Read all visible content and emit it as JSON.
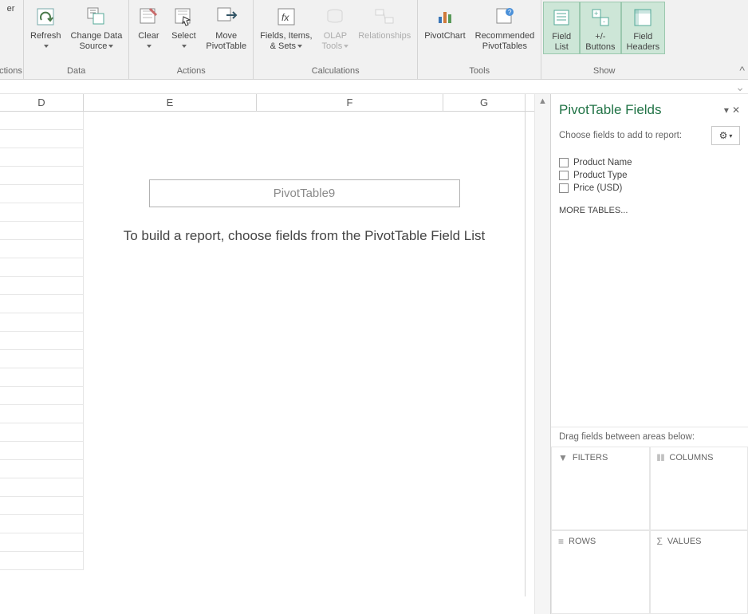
{
  "ribbon": {
    "partial_label": "ctions",
    "partial_hint": "er",
    "data": {
      "label": "Data",
      "refresh": "Refresh",
      "change_data_source": "Change Data\nSource"
    },
    "actions": {
      "label": "Actions",
      "clear": "Clear",
      "select": "Select",
      "move": "Move\nPivotTable"
    },
    "calculations": {
      "label": "Calculations",
      "fields_items_sets": "Fields, Items,\n& Sets",
      "olap_tools": "OLAP\nTools",
      "relationships": "Relationships"
    },
    "tools": {
      "label": "Tools",
      "pivotchart": "PivotChart",
      "recommended": "Recommended\nPivotTables"
    },
    "show": {
      "label": "Show",
      "field_list": "Field\nList",
      "plusminus": "+/-\nButtons",
      "field_headers": "Field\nHeaders"
    }
  },
  "columns": {
    "d": "D",
    "e": "E",
    "f": "F",
    "g": "G"
  },
  "pivot": {
    "name": "PivotTable9",
    "instructions": "To build a report, choose fields from the PivotTable Field List"
  },
  "task_pane": {
    "title": "PivotTable Fields",
    "choose_text": "Choose fields to add to report:",
    "fields": {
      "f1": "Product Name",
      "f2": "Product Type",
      "f3": "Price (USD)"
    },
    "more_tables": "MORE TABLES...",
    "drag_text": "Drag fields between areas below:",
    "areas": {
      "filters": "FILTERS",
      "columns": "COLUMNS",
      "rows": "ROWS",
      "values": "VALUES"
    }
  }
}
